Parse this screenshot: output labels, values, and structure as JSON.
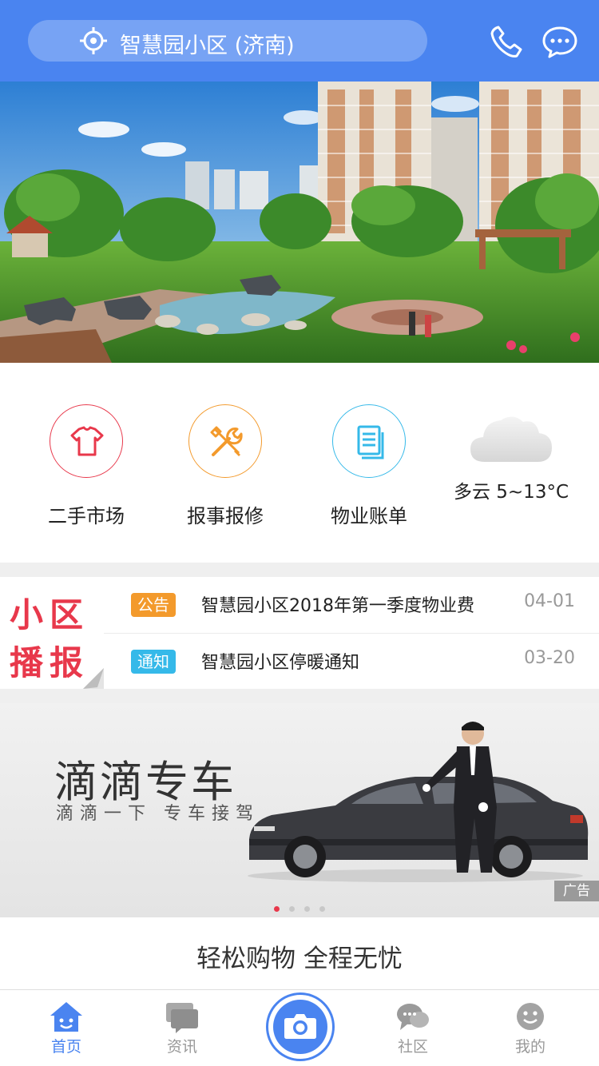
{
  "header": {
    "location": "智慧园小区 (济南)",
    "phone_icon": "phone-icon",
    "message_icon": "chat-bubble-icon",
    "color": "#4a84f0"
  },
  "banner": {
    "image": "residential-garden-illustration",
    "slide_dots": 4
  },
  "quick_actions": [
    {
      "label": "二手市场",
      "icon": "tshirt-icon",
      "color": "#e8384b"
    },
    {
      "label": "报事报修",
      "icon": "tools-icon",
      "color": "#f39a2c"
    },
    {
      "label": "物业账单",
      "icon": "document-icon",
      "color": "#35b9e9"
    }
  ],
  "weather": {
    "icon": "cloud-icon",
    "text": "多云 5~13°C"
  },
  "news": {
    "logo_line1": "小区",
    "logo_line2": "播报",
    "items": [
      {
        "tag": "公告",
        "text": "智慧园小区2018年第一季度物业费",
        "date": "04-01"
      },
      {
        "tag": "通知",
        "text": "智慧园小区停暖通知",
        "date": "03-20"
      }
    ]
  },
  "ad": {
    "title": "滴滴专车",
    "subtitle": "滴滴一下 专车接驾",
    "badge": "广告",
    "dots": 4,
    "active_dot": 0
  },
  "shop": {
    "title": "轻松购物 全程无忧"
  },
  "tabbar": {
    "items": [
      {
        "label": "首页",
        "icon": "home-icon",
        "active": true
      },
      {
        "label": "资讯",
        "icon": "news-icon",
        "active": false
      },
      {
        "label": "",
        "icon": "camera-icon",
        "active": false
      },
      {
        "label": "社区",
        "icon": "community-icon",
        "active": false
      },
      {
        "label": "我的",
        "icon": "profile-icon",
        "active": false
      }
    ]
  }
}
